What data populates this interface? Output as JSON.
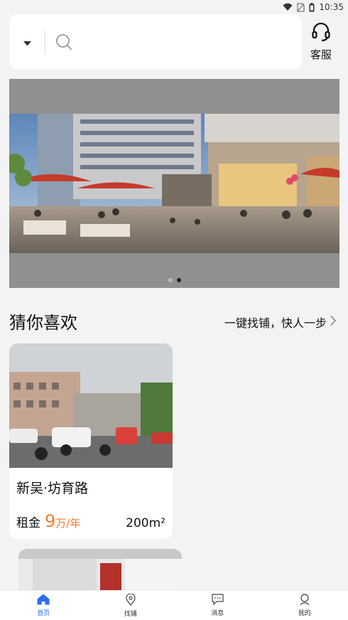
{
  "status_bar": {
    "time": "10:35",
    "icons": [
      "wifi-icon",
      "no-sim-icon",
      "battery-icon"
    ]
  },
  "search": {
    "placeholder": "",
    "value": ""
  },
  "service": {
    "label": "客服",
    "icon": "headset-icon"
  },
  "banner": {
    "slide_count": 2,
    "active_index": 1
  },
  "section": {
    "title": "猜你喜欢",
    "link": "一键找铺，快人一步"
  },
  "listings": [
    {
      "name": "新吴·坊育路",
      "rent_label": "租金",
      "rent_value": "9",
      "rent_unit": "万/年",
      "area": "200m²"
    }
  ],
  "tabbar": {
    "items": [
      {
        "label": "首页",
        "icon": "home-icon",
        "active": true
      },
      {
        "label": "找铺",
        "icon": "location-pin-icon",
        "active": false
      },
      {
        "label": "消息",
        "icon": "message-icon",
        "active": false
      },
      {
        "label": "我的",
        "icon": "user-icon",
        "active": false
      }
    ]
  },
  "colors": {
    "accent": "#2a6ff3",
    "price": "#ee7a2c",
    "banner_bg": "#909090"
  }
}
